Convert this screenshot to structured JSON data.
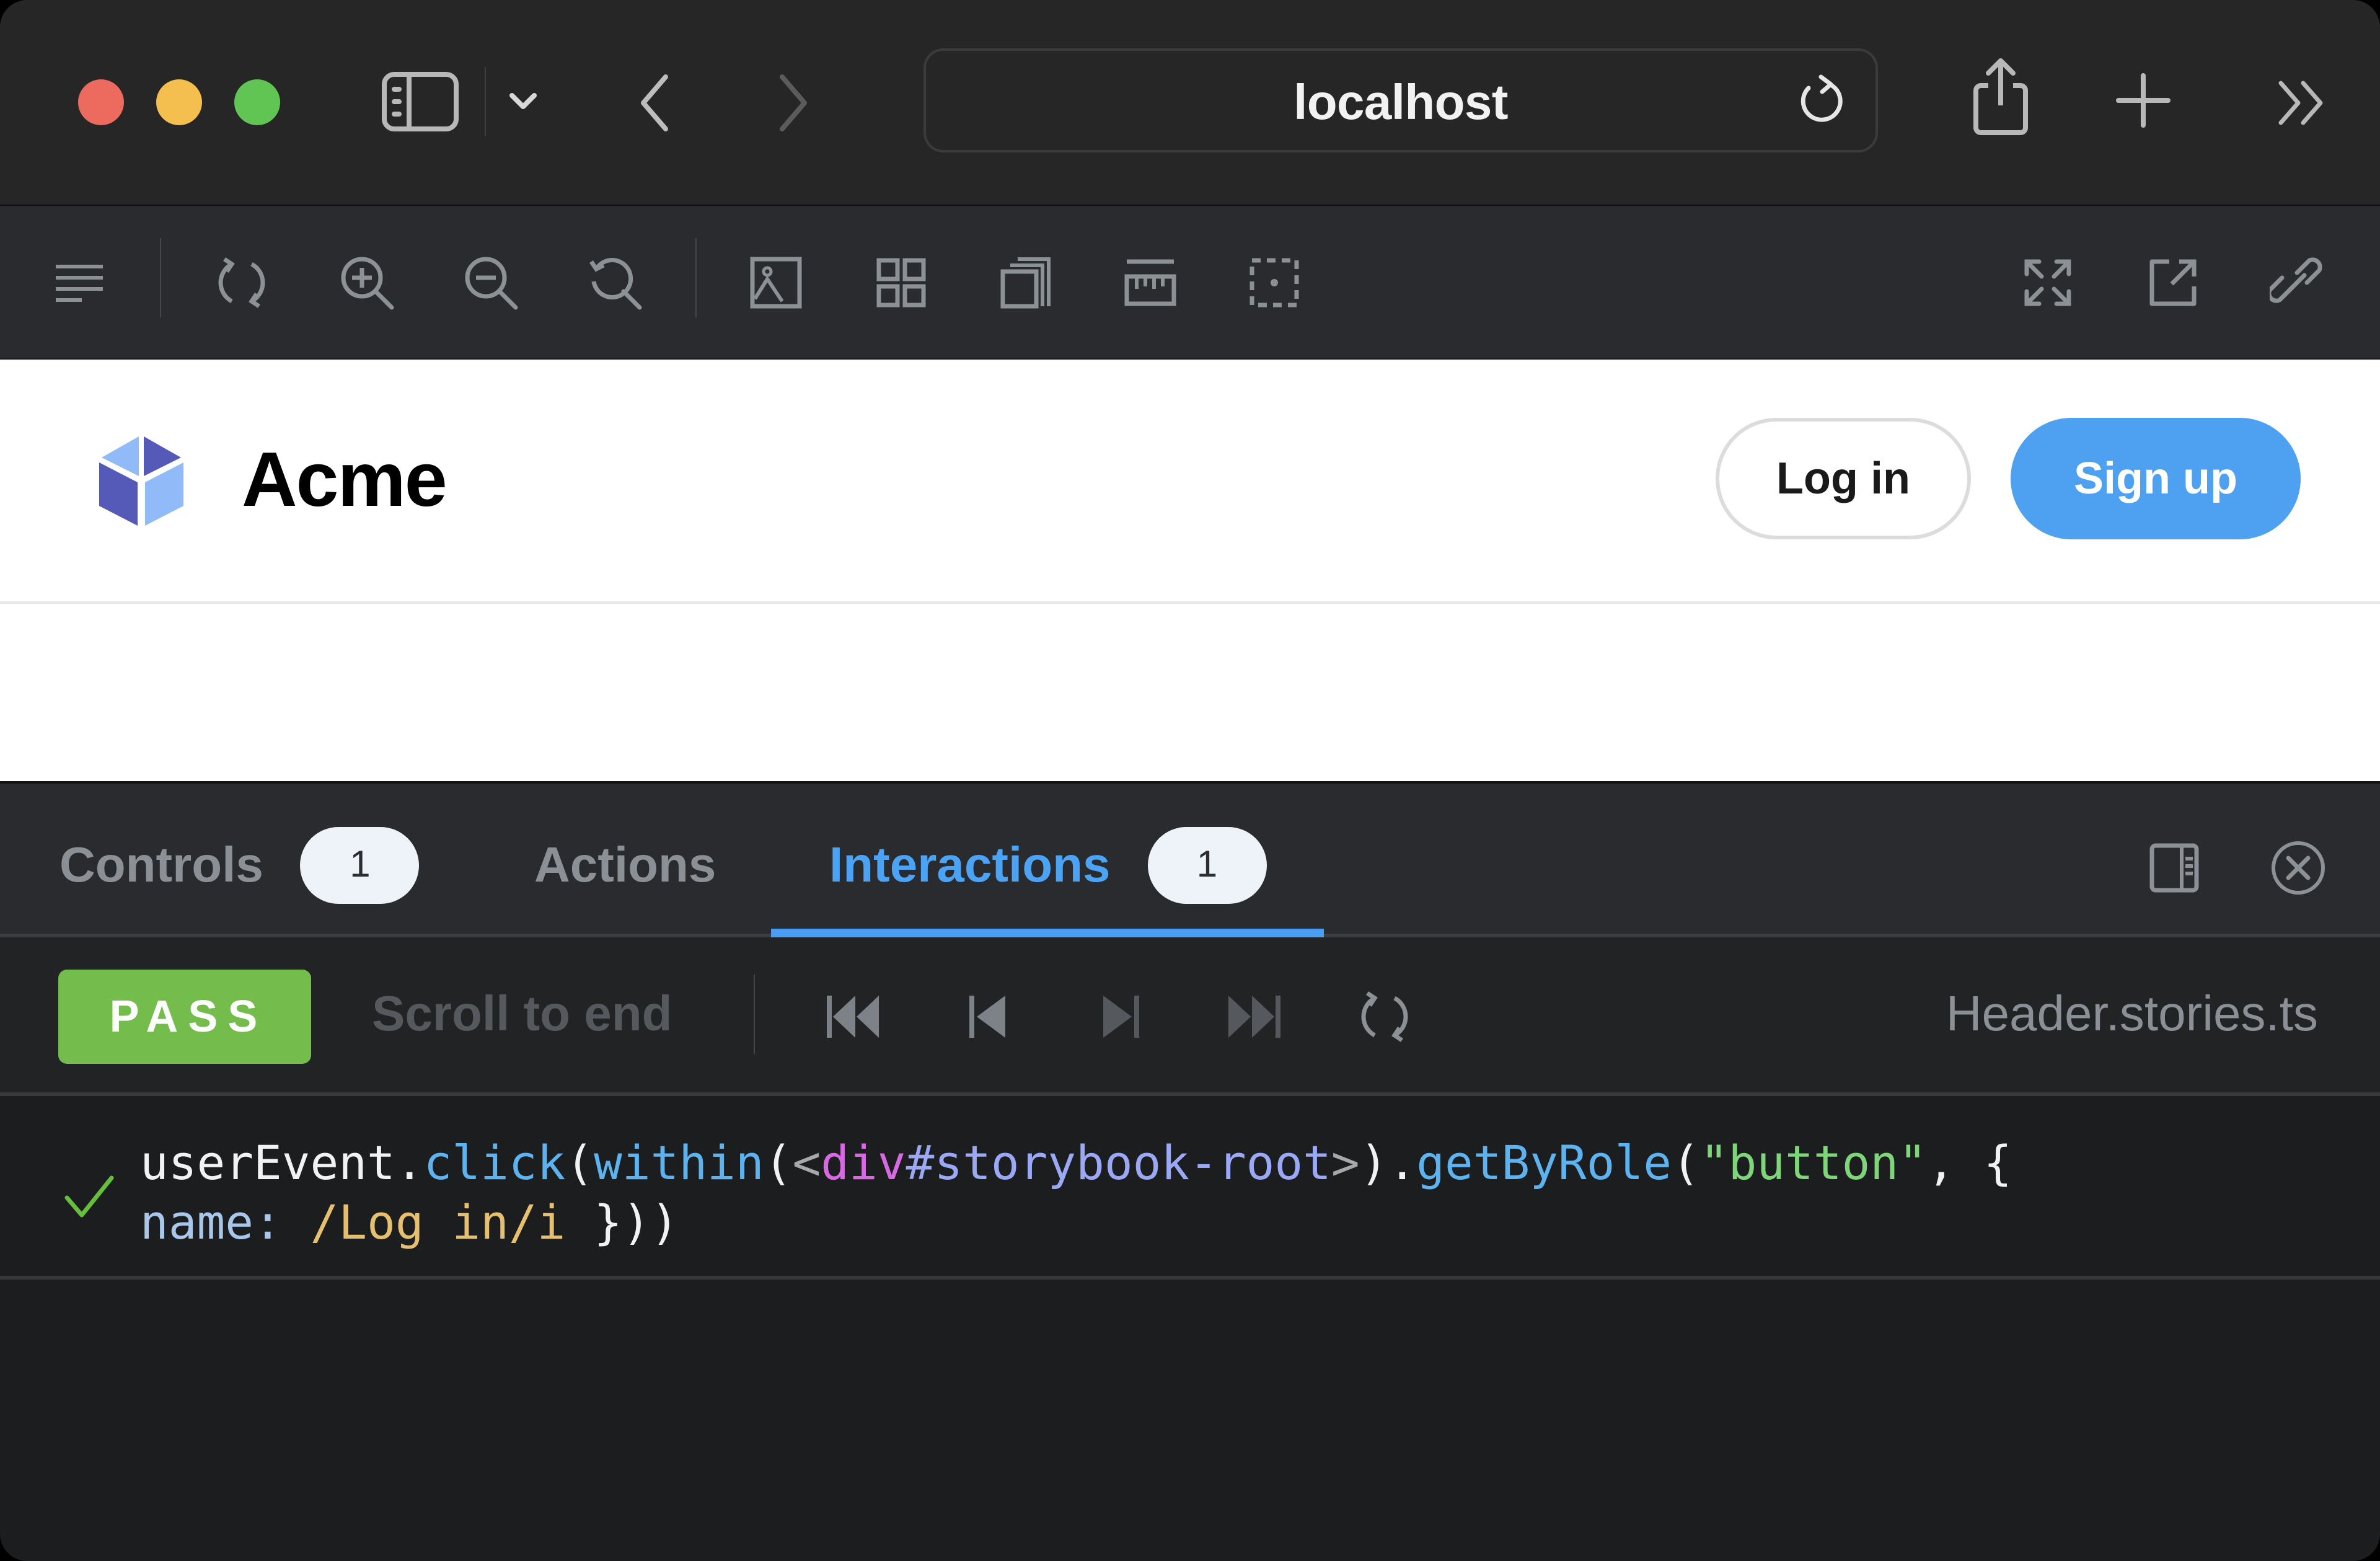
{
  "browser": {
    "url": "localhost",
    "traffic_lights": {
      "close": "#ed6a5e",
      "minimize": "#f5bf4f",
      "zoom": "#61c554"
    },
    "icons": {
      "sidebar": "sidebar-icon",
      "sidebar_menu": "chevron-down-icon",
      "back": "chevron-left-icon",
      "forward": "chevron-right-icon",
      "reload": "reload-icon",
      "share": "share-icon",
      "new_tab": "plus-icon",
      "overflow": "double-chevron-right-icon"
    }
  },
  "storybook_toolbar": {
    "left_tools": [
      {
        "name": "toggle-sidebar",
        "icon": "menu-lines-icon"
      },
      {
        "name": "remount",
        "icon": "sync-icon"
      },
      {
        "name": "zoom-in",
        "icon": "zoom-in-icon"
      },
      {
        "name": "zoom-out",
        "icon": "zoom-out-icon"
      },
      {
        "name": "zoom-reset",
        "icon": "zoom-reset-icon"
      },
      {
        "name": "backgrounds",
        "icon": "image-icon"
      },
      {
        "name": "grid",
        "icon": "grid-icon"
      },
      {
        "name": "viewport",
        "icon": "viewport-icon"
      },
      {
        "name": "measure",
        "icon": "ruler-icon"
      },
      {
        "name": "outline",
        "icon": "outline-icon"
      }
    ],
    "right_tools": [
      {
        "name": "fullscreen",
        "icon": "expand-icon"
      },
      {
        "name": "open-new-tab",
        "icon": "external-link-icon"
      },
      {
        "name": "copy-link",
        "icon": "link-icon"
      }
    ]
  },
  "preview": {
    "brand": "Acme",
    "logo_colors": {
      "dark": "#555ab9",
      "light": "#91baf8"
    },
    "login_label": "Log in",
    "signup_label": "Sign up",
    "accent": "#4ea0f1"
  },
  "addons": {
    "tabs": [
      {
        "label": "Controls",
        "badge": "1",
        "active": false
      },
      {
        "label": "Actions",
        "badge": null,
        "active": false
      },
      {
        "label": "Interactions",
        "badge": "1",
        "active": true
      }
    ],
    "active_color": "#4aa3f5",
    "right_icons": [
      "panel-orientation-icon",
      "close-circle-icon"
    ]
  },
  "interactions": {
    "status": "PASS",
    "status_color": "#74bc4b",
    "scroll_to_end": "Scroll to end",
    "controls": [
      "rewind-icon",
      "step-back-icon",
      "step-forward-icon",
      "fast-forward-icon",
      "rerun-icon"
    ],
    "file": "Header.stories.ts",
    "steps": [
      {
        "status": "passed",
        "tokens": {
          "obj": "userEvent",
          "dot1": ".",
          "method": "click",
          "paren1": "(",
          "within": "within",
          "paren2": "(",
          "lt": "<",
          "tag": "div",
          "selector": "#storybook-root",
          "gt": ">",
          "paren3": ")",
          "dot2": ".",
          "query": "getByRole",
          "paren4": "(",
          "role": "\"button\"",
          "comma": ", {",
          "key": "name:",
          "regex": "/Log in/i",
          "close": "}))"
        }
      }
    ]
  }
}
